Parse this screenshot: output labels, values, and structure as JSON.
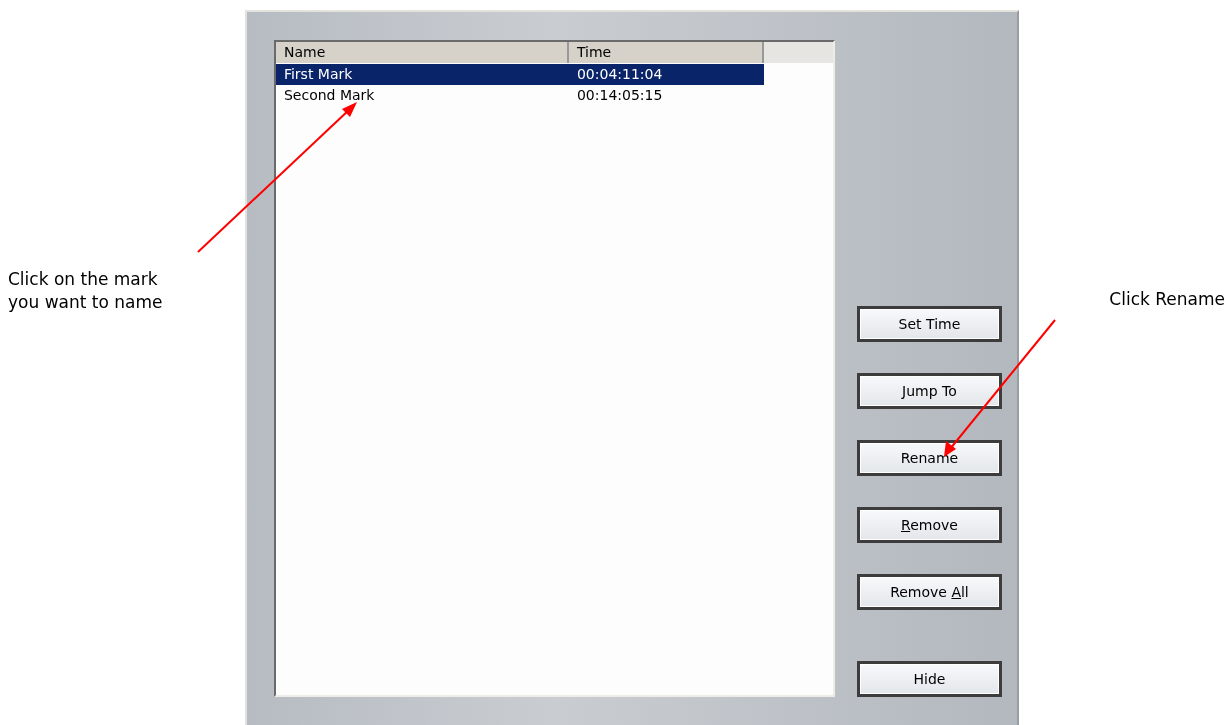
{
  "list": {
    "columns": [
      "Name",
      "Time"
    ],
    "rows": [
      {
        "name": "First Mark",
        "time": "00:04:11:04",
        "selected": true
      },
      {
        "name": "Second Mark",
        "time": "00:14:05:15",
        "selected": false
      }
    ]
  },
  "buttons": [
    {
      "label": "Set Time"
    },
    {
      "label": "Jump To"
    },
    {
      "label": "Rename"
    },
    {
      "access_key": "R",
      "label_post": "emove"
    },
    {
      "label_pre": "Remove ",
      "access_key": "A",
      "label_post": "ll"
    }
  ],
  "hide_button": {
    "label": "Hide"
  },
  "left_note": "Click on the mark you want to name",
  "right_note": "Click Rename"
}
